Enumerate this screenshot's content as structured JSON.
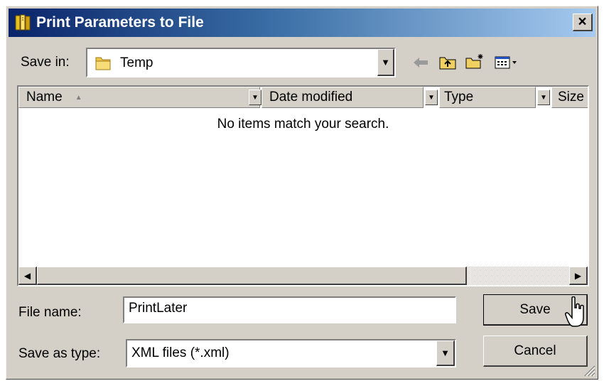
{
  "window": {
    "title": "Print Parameters to File",
    "close_glyph": "×"
  },
  "save_in": {
    "label": "Save in:",
    "value": "Temp",
    "icon": "folder-icon"
  },
  "toolbar": {
    "icons": [
      "back-arrow-icon",
      "up-one-level-icon",
      "new-folder-icon",
      "view-menu-icon"
    ]
  },
  "file_list": {
    "columns": [
      {
        "label": "Name",
        "sort": "ascending"
      },
      {
        "label": "Date modified"
      },
      {
        "label": "Type"
      },
      {
        "label": "Size"
      }
    ],
    "empty_message": "No items match your search."
  },
  "file_name": {
    "label": "File name:",
    "value": "PrintLater"
  },
  "save_as_type": {
    "label": "Save as type:",
    "value": "XML files (*.xml)"
  },
  "buttons": {
    "save": "Save",
    "cancel": "Cancel"
  }
}
